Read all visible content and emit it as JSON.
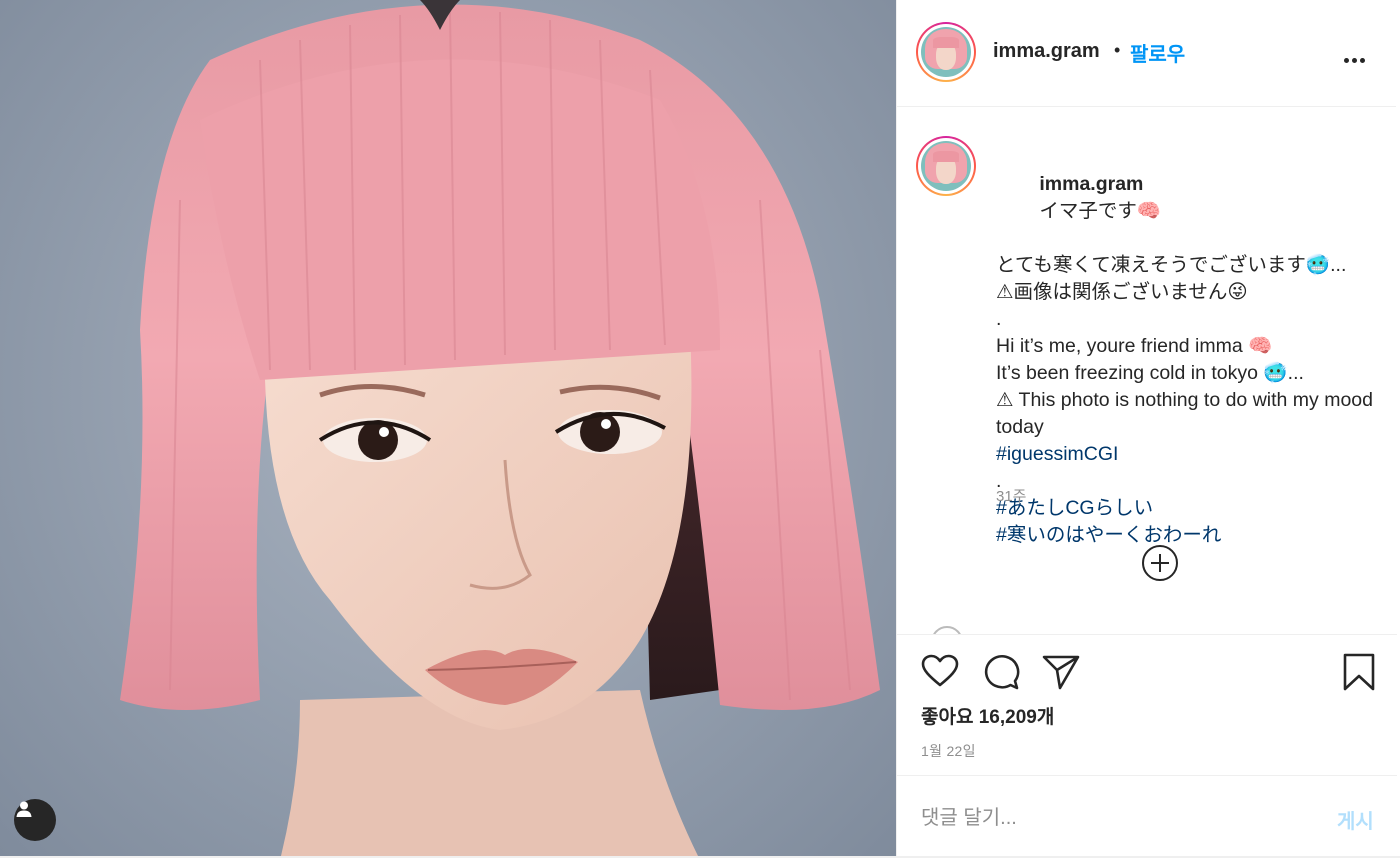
{
  "post": {
    "author": "imma.gram",
    "separator": "•",
    "follow_label": "팔로우",
    "more_icon": "more-horizontal-icon",
    "caption_lines": [
      "とても寒くて凍えそうでございます🥶...",
      "⚠画像は関係ございません😜",
      ".",
      "Hi it’s me, youre friend imma 🧠",
      "It’s been freezing cold in tokyo 🥶...",
      "⚠ This photo is nothing to do with my mood today"
    ],
    "caption_first": "イマ子です🧠",
    "hashtags": [
      "#iguessimCGI",
      "#あたしCGらしい",
      "#寒いのはやーくおわーれ"
    ],
    "dot_line": ".",
    "time_ago": "31주",
    "likes_text": "좋아요 16,209개",
    "date": "1월 22일",
    "comment_placeholder": "댓글 달기...",
    "post_label": "게시",
    "colors": {
      "accent": "#0095f6",
      "hashtag": "#00376b",
      "muted": "#8e8e8e",
      "post_disabled": "#b2dffc",
      "hair": "#f0a3ad"
    }
  }
}
